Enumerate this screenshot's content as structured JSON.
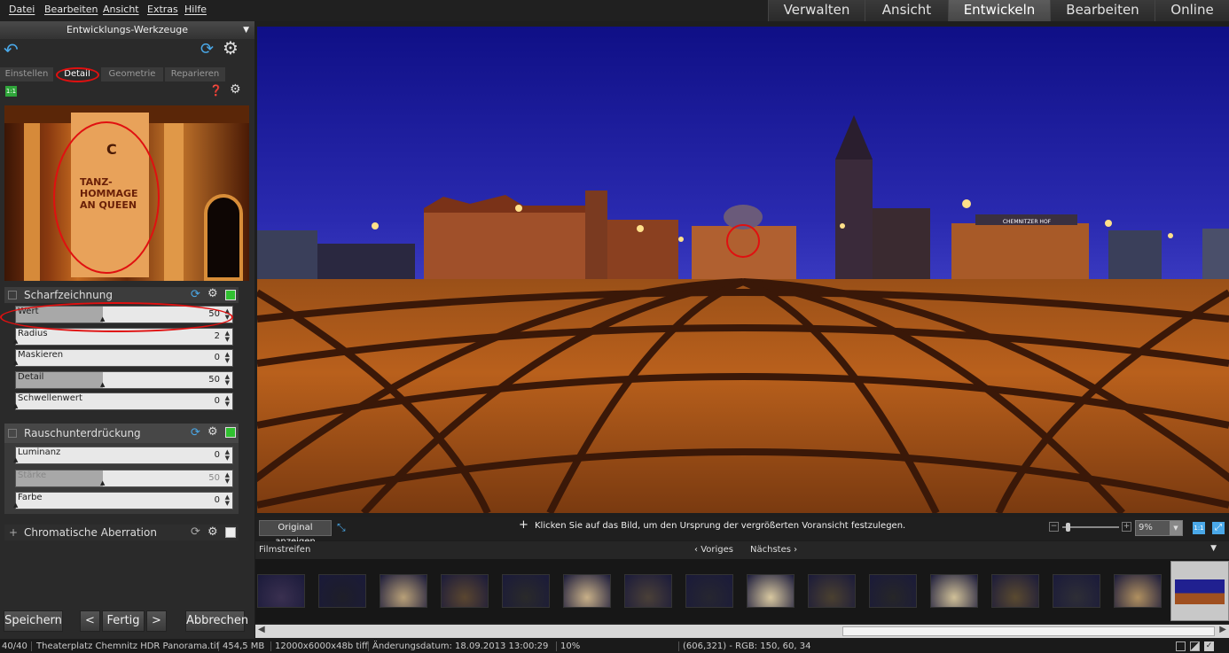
{
  "menu": [
    "Datei",
    "Bearbeiten",
    "Ansicht",
    "Extras",
    "Hilfe"
  ],
  "modes": [
    "Verwalten",
    "Ansicht",
    "Entwickeln",
    "Bearbeiten",
    "Online"
  ],
  "active_mode": "Entwickeln",
  "left_panel": {
    "header": "Entwicklungs-Werkzeuge",
    "tabs": [
      "Einstellen",
      "Detail",
      "Geometrie",
      "Reparieren"
    ],
    "active_tab": "Detail",
    "preview_sign": {
      "line1": "TANZ-",
      "line2": "HOMMAGE",
      "line3": "AN QUEEN"
    },
    "one_to_one": "1:1",
    "sharpening": {
      "title": "Scharfzeichnung",
      "sliders": [
        {
          "label": "Wert",
          "value": "50",
          "fraction": 0.5
        },
        {
          "label": "Radius",
          "value": "2",
          "fraction": 0.0
        },
        {
          "label": "Maskieren",
          "value": "0",
          "fraction": 0.0
        },
        {
          "label": "Detail",
          "value": "50",
          "fraction": 0.5
        },
        {
          "label": "Schwellenwert",
          "value": "0",
          "fraction": 0.0
        }
      ]
    },
    "noise": {
      "title": "Rauschunterdrückung",
      "sliders": [
        {
          "label": "Luminanz",
          "value": "0",
          "fraction": 0.0
        },
        {
          "label": "Stärke",
          "value": "50",
          "fraction": 0.5,
          "disabled": true
        },
        {
          "label": "Farbe",
          "value": "0",
          "fraction": 0.0
        }
      ]
    },
    "chromatic": {
      "title": "Chromatische Aberration"
    },
    "buttons": {
      "save": "Speichern",
      "prev": "<",
      "done": "Fertig",
      "next": ">",
      "cancel": "Abbrechen"
    }
  },
  "viewer": {
    "original_button": "Original anzeigen",
    "hint": "Klicken Sie auf das Bild, um den Ursprung der vergrößerten Voransicht festzulegen.",
    "zoom_value": "9%",
    "zoom_11": "1:1",
    "building_sign": "CHEMNITZER HOF"
  },
  "filmstrip": {
    "title": "Filmstreifen",
    "prev": "Voriges",
    "next": "Nächstes",
    "thumb_count": 16
  },
  "status": {
    "count": "40/40",
    "file": "Theaterplatz Chemnitz HDR Panorama.tif",
    "size": "454,5 MB",
    "dims": "12000x6000x48b tiff",
    "date": "Änderungsdatum: 18.09.2013 13:00:29",
    "zoom": "10%",
    "pixel": "(606,321) - RGB: 150, 60, 34"
  },
  "colors": {
    "accent_red": "#e01010",
    "bg": "#2a2a2a",
    "active_tab": "#5c5c5c"
  }
}
